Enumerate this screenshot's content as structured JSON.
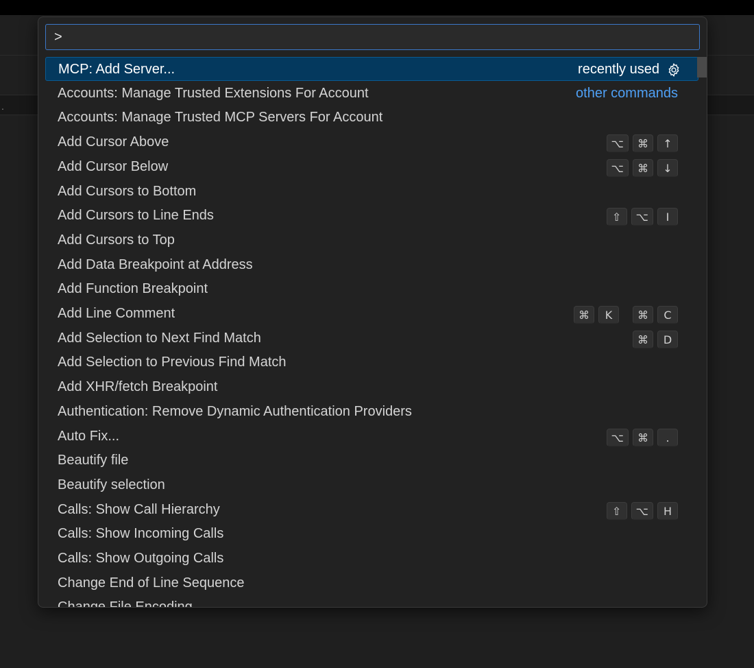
{
  "palette": {
    "input_value": ">",
    "items": [
      {
        "label": "MCP: Add Server...",
        "right_text": "recently used"
      },
      {
        "label": "Accounts: Manage Trusted Extensions For Account",
        "right_text": "other commands"
      },
      {
        "label": "Accounts: Manage Trusted MCP Servers For Account"
      },
      {
        "label": "Add Cursor Above",
        "keys": [
          "⌥",
          "⌘",
          "↑"
        ]
      },
      {
        "label": "Add Cursor Below",
        "keys": [
          "⌥",
          "⌘",
          "↓"
        ]
      },
      {
        "label": "Add Cursors to Bottom"
      },
      {
        "label": "Add Cursors to Line Ends",
        "keys": [
          "⇧",
          "⌥",
          "I"
        ]
      },
      {
        "label": "Add Cursors to Top"
      },
      {
        "label": "Add Data Breakpoint at Address"
      },
      {
        "label": "Add Function Breakpoint"
      },
      {
        "label": "Add Line Comment",
        "keys": [
          "⌘",
          "K"
        ],
        "keys2": [
          "⌘",
          "C"
        ]
      },
      {
        "label": "Add Selection to Next Find Match",
        "keys": [
          "⌘",
          "D"
        ]
      },
      {
        "label": "Add Selection to Previous Find Match"
      },
      {
        "label": "Add XHR/fetch Breakpoint"
      },
      {
        "label": "Authentication: Remove Dynamic Authentication Providers"
      },
      {
        "label": "Auto Fix...",
        "keys": [
          "⌥",
          "⌘",
          "."
        ]
      },
      {
        "label": "Beautify file"
      },
      {
        "label": "Beautify selection"
      },
      {
        "label": "Calls: Show Call Hierarchy",
        "keys": [
          "⇧",
          "⌥",
          "H"
        ]
      },
      {
        "label": "Calls: Show Incoming Calls"
      },
      {
        "label": "Calls: Show Outgoing Calls"
      },
      {
        "label": "Change End of Line Sequence"
      },
      {
        "label": "Change File Encoding"
      }
    ]
  },
  "icons": {
    "settings": "gear-icon"
  },
  "colors": {
    "accent": "#3b78c9",
    "selected_bg": "#04395e",
    "link": "#4fa0f5"
  }
}
